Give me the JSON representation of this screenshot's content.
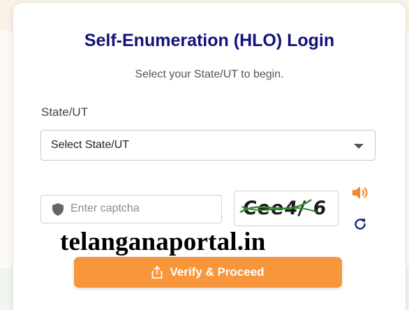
{
  "login": {
    "title": "Self-Enumeration (HLO) Login",
    "subtitle": "Select your State/UT to begin.",
    "state_label": "State/UT",
    "state_select_value": "Select State/UT",
    "captcha_placeholder": "Enter captcha",
    "captcha_text": "Cee4/ 6",
    "verify_label": "Verify & Proceed"
  },
  "watermark": "telanganaportal.in",
  "icons": {
    "shield": "shield-icon",
    "speaker": "speaker-icon",
    "refresh": "refresh-icon",
    "share": "share-icon",
    "dropdown": "chevron-down-icon"
  },
  "colors": {
    "title": "#11127a",
    "button": "#f8963b",
    "speaker": "#f08a2c",
    "refresh": "#1a237e"
  }
}
